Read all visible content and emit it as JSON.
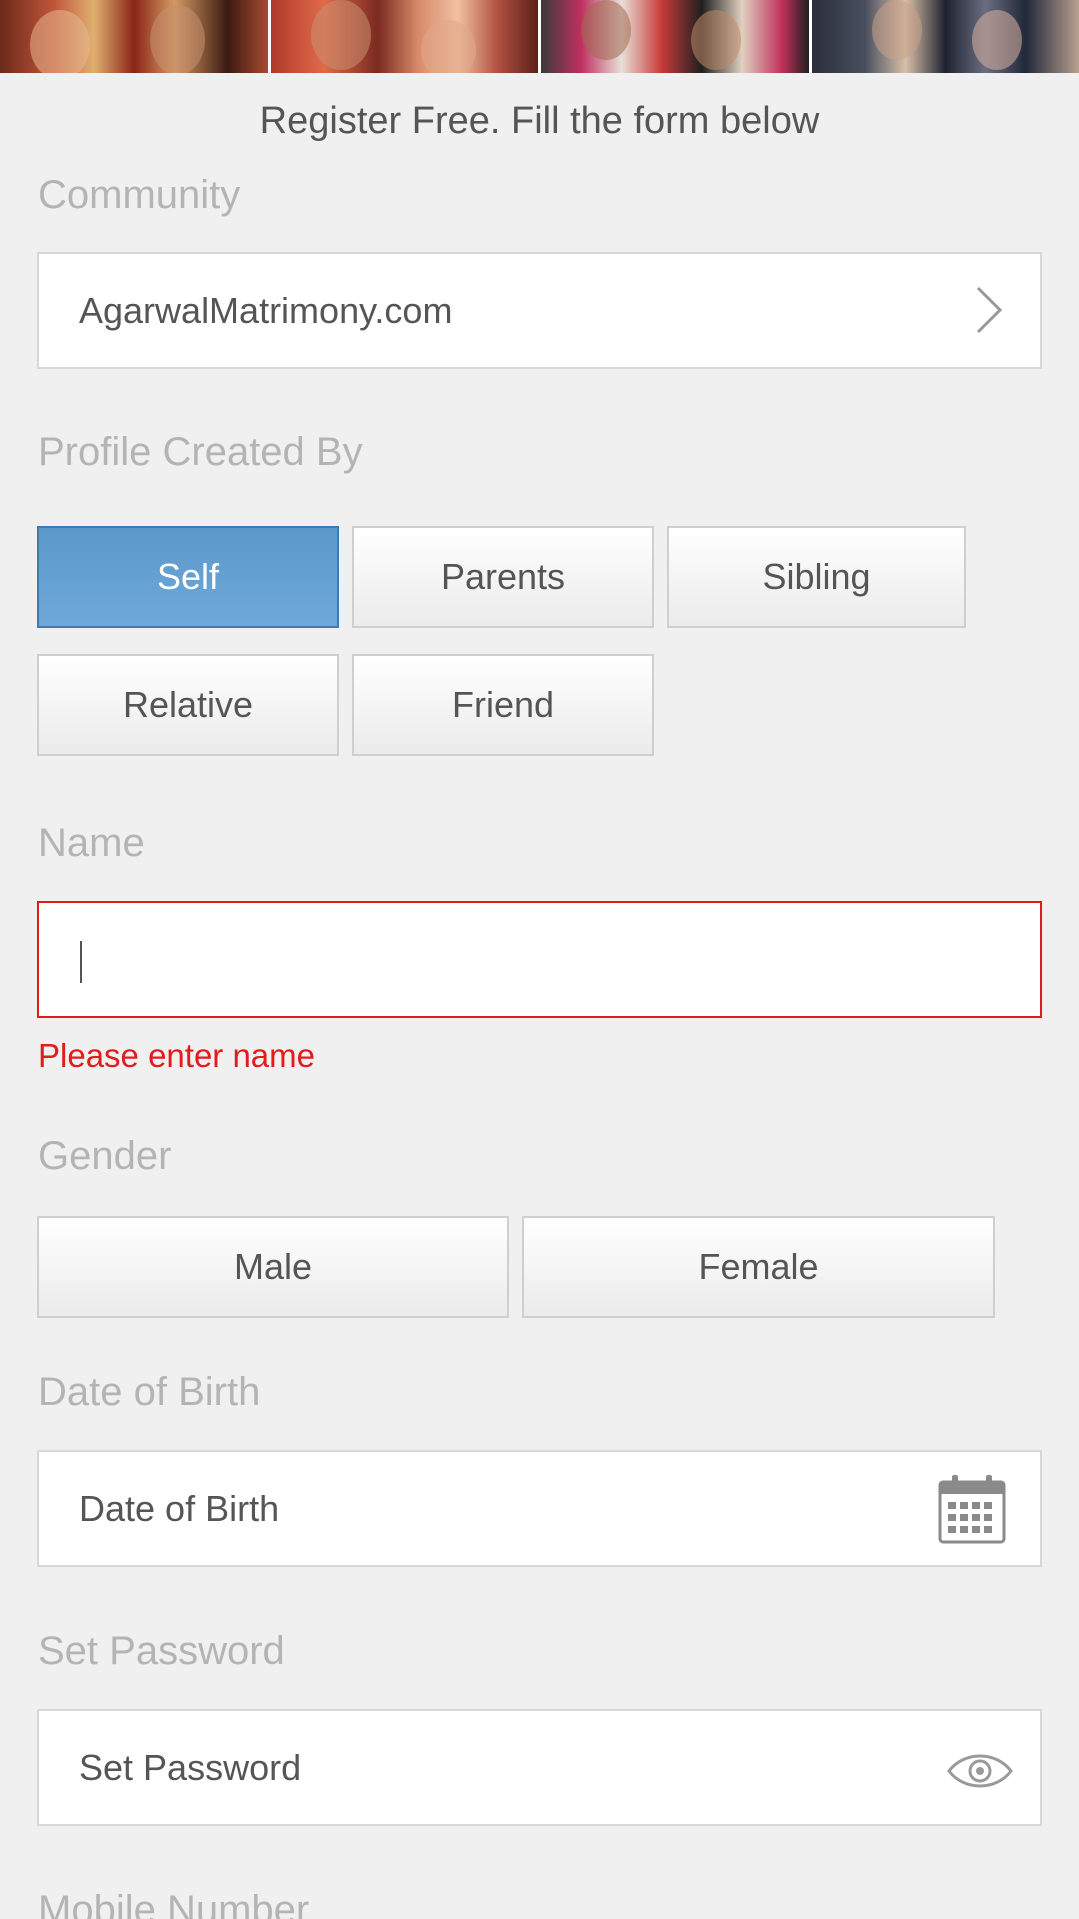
{
  "banner": {
    "photos": [
      "couple-photo-1",
      "couple-photo-2",
      "couple-photo-3",
      "couple-photo-4"
    ]
  },
  "form": {
    "heading": "Register Free. Fill the form below",
    "community": {
      "label": "Community",
      "value": "AgarwalMatrimony.com"
    },
    "profile_created_by": {
      "label": "Profile Created By",
      "options": [
        "Self",
        "Parents",
        "Sibling",
        "Relative",
        "Friend"
      ],
      "selected": "Self"
    },
    "name": {
      "label": "Name",
      "value": "",
      "error": "Please enter name"
    },
    "gender": {
      "label": "Gender",
      "options": [
        "Male",
        "Female"
      ]
    },
    "dob": {
      "label": "Date of Birth",
      "placeholder": "Date of Birth"
    },
    "password": {
      "label": "Set Password",
      "placeholder": "Set Password"
    },
    "mobile": {
      "label": "Mobile Number"
    }
  },
  "colors": {
    "accent": "#5b99cb",
    "error": "#e21b1b",
    "label": "#b4b4b4"
  }
}
